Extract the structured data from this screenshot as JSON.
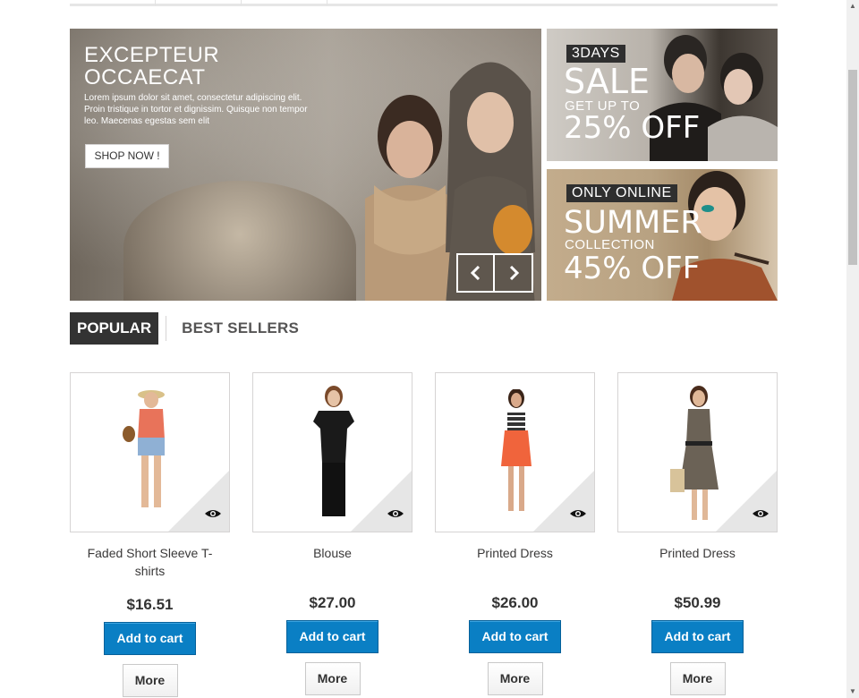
{
  "hero": {
    "title": "EXCEPTEUR OCCAECAT",
    "text": "Lorem ipsum dolor sit amet, consectetur adipiscing elit. Proin tristique in tortor et dignissim. Quisque non tempor leo. Maecenas egestas sem elit",
    "button": "SHOP NOW !",
    "prev_icon": "chevron-left-icon",
    "next_icon": "chevron-right-icon"
  },
  "banner_sale": {
    "tag": "3DAYS",
    "headline": "SALE",
    "subline": "GET UP TO",
    "discount": "25% OFF"
  },
  "banner_summer": {
    "tag": "ONLY ONLINE",
    "headline": "SUMMER",
    "subline": "COLLECTION",
    "discount": "45% OFF"
  },
  "tabs": {
    "active": "POPULAR",
    "other": "BEST SELLERS"
  },
  "products": [
    {
      "name": "Faded Short Sleeve T-shirts",
      "price": "$16.51",
      "cart": "Add to cart",
      "more": "More",
      "dress_color": "#e8735a"
    },
    {
      "name": "Blouse",
      "price": "$27.00",
      "cart": "Add to cart",
      "more": "More",
      "dress_color": "#1a1a1a"
    },
    {
      "name": "Printed Dress",
      "price": "$26.00",
      "cart": "Add to cart",
      "more": "More",
      "dress_color": "#f0643c"
    },
    {
      "name": "Printed Dress",
      "price": "$50.99",
      "cart": "Add to cart",
      "more": "More",
      "dress_color": "#6b6256"
    }
  ],
  "colors": {
    "accent": "#0a7fc4",
    "tab_active_bg": "#333333"
  }
}
